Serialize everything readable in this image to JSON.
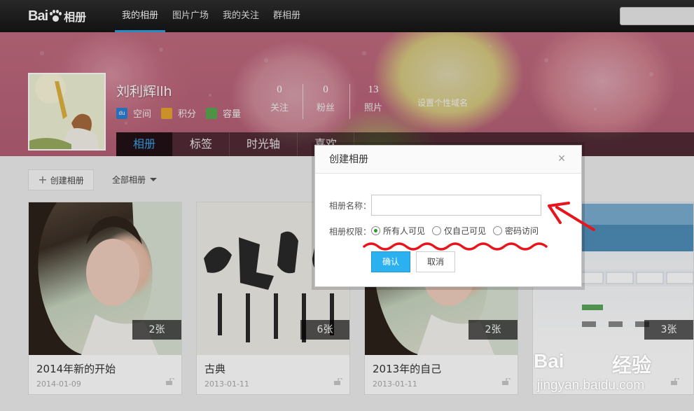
{
  "brand": {
    "logo_text_left": "Bai",
    "logo_text_right": "相册"
  },
  "nav": {
    "items": [
      "我的相册",
      "图片广场",
      "我的关注",
      "群相册"
    ],
    "active_index": 0
  },
  "search": {
    "placeholder": ""
  },
  "profile": {
    "name": "刘利辉llh",
    "links": [
      {
        "label": "空间",
        "icon": "du-space-icon"
      },
      {
        "label": "积分",
        "icon": "points-icon"
      },
      {
        "label": "容量",
        "icon": "capacity-icon"
      }
    ],
    "stats": [
      {
        "value": "0",
        "label": "关注"
      },
      {
        "value": "0",
        "label": "粉丝"
      },
      {
        "value": "13",
        "label": "照片"
      }
    ],
    "custom_domain_label": "设置个性域名"
  },
  "subnav": {
    "tabs": [
      "相册",
      "标签",
      "时光轴",
      "喜欢"
    ],
    "active_index": 0
  },
  "toolbar": {
    "create_label": "创建相册",
    "filter_label": "全部相册"
  },
  "albums": [
    {
      "title": "2014年新的开始",
      "date": "2014-01-09",
      "count": "2张"
    },
    {
      "title": "古典",
      "date": "2013-01-11",
      "count": "6张"
    },
    {
      "title": "2013年的自己",
      "date": "2013-01-11",
      "count": "2张"
    },
    {
      "title": "baidu_jingyan",
      "date": "",
      "count": "3张"
    }
  ],
  "dialog": {
    "title": "创建相册",
    "close_glyph": "×",
    "name_label": "相册名称：",
    "name_value": "",
    "name_placeholder": "",
    "permission_label": "相册权限：",
    "options": [
      "所有人可见",
      "仅自己可见",
      "密码访问"
    ],
    "selected_option": 0,
    "ok_label": "确认",
    "cancel_label": "取消"
  },
  "watermark": {
    "logo": "Bai",
    "cn": "经验",
    "url": "jingyan.baidu.com"
  },
  "colors": {
    "accent": "#2cb1f0",
    "annotation": "#e8141b",
    "topbar": "#1c1c1c"
  }
}
